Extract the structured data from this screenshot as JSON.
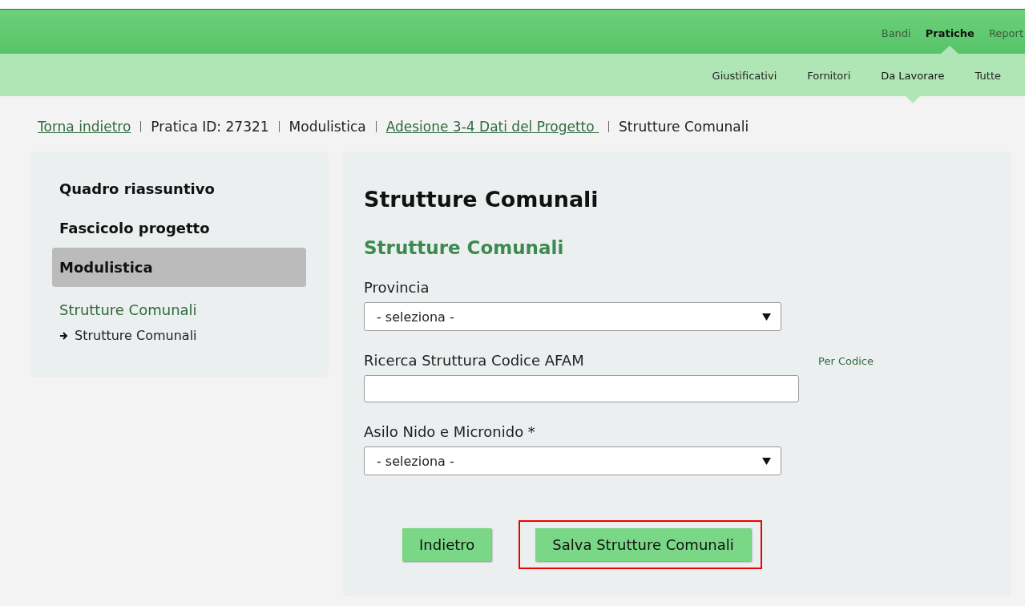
{
  "top_nav": {
    "items": [
      {
        "label": "Bandi",
        "selected": false
      },
      {
        "label": "Pratiche",
        "selected": true
      },
      {
        "label": "Report",
        "selected": false
      }
    ]
  },
  "sub_nav": {
    "items": [
      {
        "label": "Giustificativi",
        "selected": false
      },
      {
        "label": "Fornitori",
        "selected": false
      },
      {
        "label": "Da Lavorare",
        "selected": true
      },
      {
        "label": "Tutte",
        "selected": false
      }
    ]
  },
  "breadcrumb": [
    {
      "label": "Torna indietro",
      "kind": "link"
    },
    {
      "label": "Pratica ID: 27321",
      "kind": "text"
    },
    {
      "label": "Modulistica",
      "kind": "text"
    },
    {
      "label": "Adesione 3-4 Dati del Progetto ",
      "kind": "link"
    },
    {
      "label": "Strutture Comunali",
      "kind": "text"
    }
  ],
  "sidebar": {
    "items": [
      {
        "label": "Quadro riassuntivo",
        "selected": false
      },
      {
        "label": "Fascicolo progetto",
        "selected": false
      },
      {
        "label": "Modulistica",
        "selected": true
      }
    ],
    "section": {
      "title": "Strutture Comunali",
      "children": [
        {
          "label": "Strutture Comunali"
        }
      ]
    }
  },
  "form": {
    "title": "Strutture Comunali",
    "subtitle": "Strutture Comunali",
    "fields": [
      {
        "kind": "select",
        "label": "Provincia",
        "value": "- seleziona -"
      },
      {
        "kind": "text",
        "label": "Ricerca Struttura Codice AFAM",
        "hint": "Per Codice"
      },
      {
        "kind": "select",
        "label": "Asilo Nido e Micronido *",
        "value": "- seleziona -"
      }
    ],
    "buttons": [
      {
        "label": "Indietro",
        "highlighted": false
      },
      {
        "label": "Salva Strutture Comunali",
        "highlighted": true
      }
    ]
  }
}
